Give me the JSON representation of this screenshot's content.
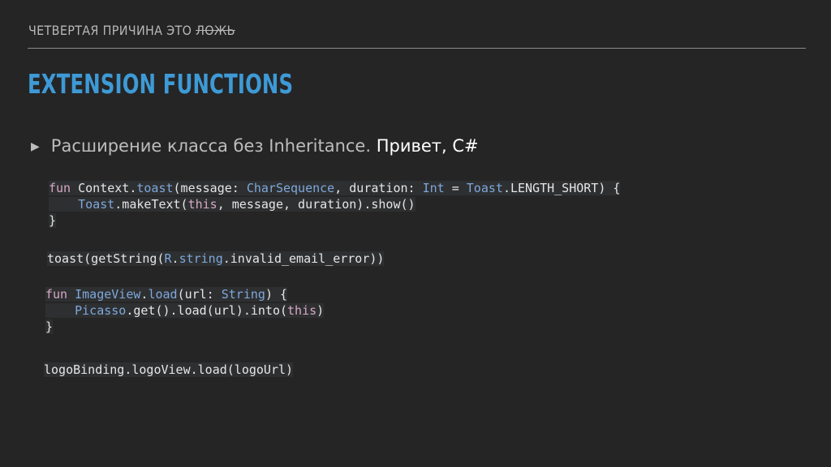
{
  "header": {
    "text_main": "ЧЕТВЕРТАЯ ПРИЧИНА ЭТО ",
    "text_struck": "ЛОЖЬ"
  },
  "title": "EXTENSION FUNCTIONS",
  "bullet": {
    "icon": "triangle-right-icon",
    "text_main": "Расширение класса без Inheritance. ",
    "text_highlight": "Привет, C#"
  },
  "code_blocks": [
    {
      "lines": [
        [
          [
            "kw",
            "fun "
          ],
          [
            "pl",
            "Context."
          ],
          [
            "fn",
            "toast"
          ],
          [
            "pl",
            "(message: "
          ],
          [
            "ty",
            "CharSequence"
          ],
          [
            "pl",
            ", duration: "
          ],
          [
            "ty",
            "Int"
          ],
          [
            "pl",
            " = "
          ],
          [
            "ty",
            "Toast"
          ],
          [
            "pl",
            ".LENGTH_SHORT) {"
          ]
        ],
        [
          [
            "pl",
            "    "
          ],
          [
            "ty",
            "Toast"
          ],
          [
            "pl",
            ".makeText("
          ],
          [
            "th",
            "this"
          ],
          [
            "pl",
            ", message, duration).show()"
          ]
        ],
        [
          [
            "pl",
            "}"
          ]
        ]
      ]
    },
    {
      "lines": [
        [
          [
            "pl",
            "toast(getString("
          ],
          [
            "ty",
            "R"
          ],
          [
            "pl",
            "."
          ],
          [
            "fn",
            "string"
          ],
          [
            "pl",
            ".invalid_email_error))"
          ]
        ]
      ]
    },
    {
      "lines": [
        [
          [
            "kw",
            "fun "
          ],
          [
            "ty",
            "ImageView"
          ],
          [
            "pl",
            "."
          ],
          [
            "fn",
            "load"
          ],
          [
            "pl",
            "(url: "
          ],
          [
            "ty",
            "String"
          ],
          [
            "pl",
            ") {"
          ]
        ],
        [
          [
            "pl",
            "    "
          ],
          [
            "ty",
            "Picasso"
          ],
          [
            "pl",
            ".get().load(url).into("
          ],
          [
            "th",
            "this"
          ],
          [
            "pl",
            ")"
          ]
        ],
        [
          [
            "pl",
            "}"
          ]
        ]
      ]
    },
    {
      "lines": [
        [
          [
            "pl",
            "logoBinding.logoView.load(logoUrl)"
          ]
        ]
      ]
    }
  ],
  "colors": {
    "background": "#252526",
    "title": "#3e9ad6",
    "keyword": "#d7a8c7",
    "type": "#7ea8dc"
  }
}
